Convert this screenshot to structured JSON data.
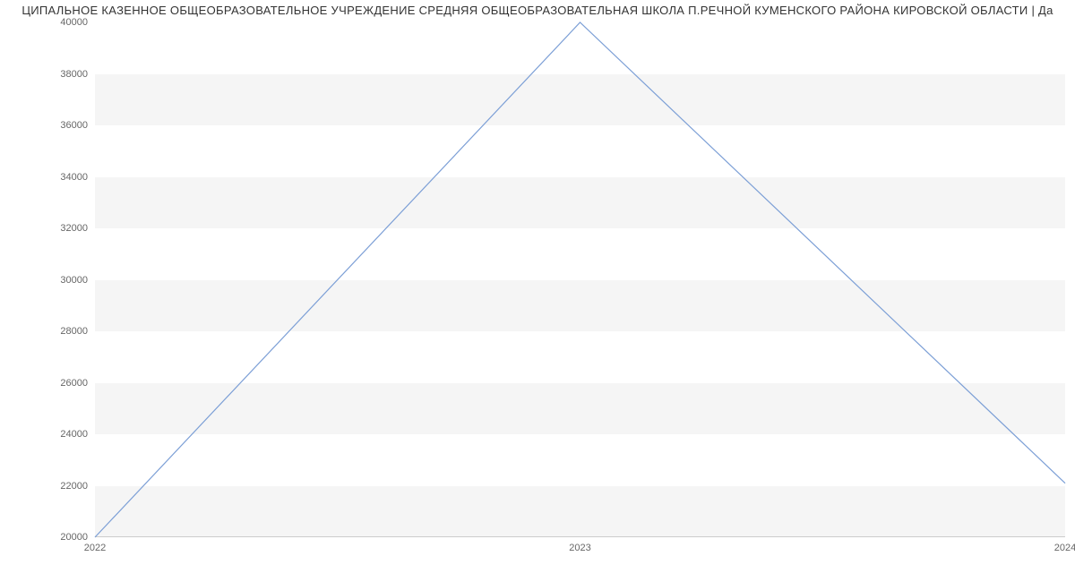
{
  "chart_data": {
    "type": "line",
    "title": "ЦИПАЛЬНОЕ КАЗЕННОЕ ОБЩЕОБРАЗОВАТЕЛЬНОЕ УЧРЕЖДЕНИЕ СРЕДНЯЯ ОБЩЕОБРАЗОВАТЕЛЬНАЯ ШКОЛА П.РЕЧНОЙ КУМЕНСКОГО РАЙОНА КИРОВСКОЙ ОБЛАСТИ | Да",
    "x": [
      2022,
      2023,
      2024
    ],
    "values": [
      20000,
      40000,
      22100
    ],
    "x_ticks": [
      2022,
      2023,
      2024
    ],
    "y_ticks": [
      20000,
      22000,
      24000,
      26000,
      28000,
      30000,
      32000,
      34000,
      36000,
      38000,
      40000
    ],
    "xlim": [
      2022,
      2024
    ],
    "ylim": [
      20000,
      40000
    ],
    "line_color": "#7c9fd6",
    "stripe_color": "#f5f5f5"
  }
}
